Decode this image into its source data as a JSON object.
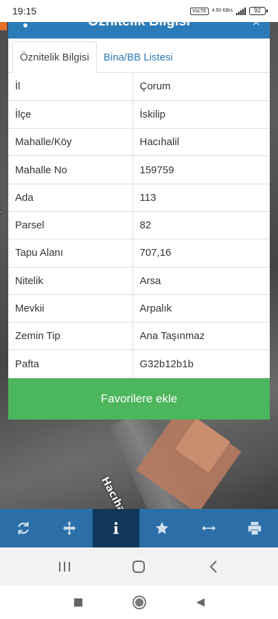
{
  "status_bar": {
    "time": "19:15",
    "network": "VoLTE",
    "speed": "4.50 KB/s",
    "battery": "92"
  },
  "panel": {
    "title": "Öznitelik Bilgisi",
    "tabs": [
      {
        "label": "Öznitelik Bilgisi",
        "active": true
      },
      {
        "label": "Bina/BB Listesi",
        "active": false
      }
    ],
    "rows": [
      {
        "key": "İl",
        "value": "Çorum"
      },
      {
        "key": "İlçe",
        "value": "İskilip"
      },
      {
        "key": "Mahalle/Köy",
        "value": "Hacıhalil"
      },
      {
        "key": "Mahalle No",
        "value": "159759"
      },
      {
        "key": "Ada",
        "value": "113"
      },
      {
        "key": "Parsel",
        "value": "82"
      },
      {
        "key": "Tapu Alanı",
        "value": "707,16"
      },
      {
        "key": "Nitelik",
        "value": "Arsa"
      },
      {
        "key": "Mevkii",
        "value": "Arpalık"
      },
      {
        "key": "Zemin Tip",
        "value": "Ana Taşınmaz"
      },
      {
        "key": "Pafta",
        "value": "G32b12b1b"
      }
    ],
    "favorite_button": "Favorilere ekle"
  },
  "map": {
    "street_label": "Hacıhali",
    "side_label": "Ha"
  },
  "toolbar": {
    "items": [
      {
        "icon": "refresh-icon",
        "active": false
      },
      {
        "icon": "move-icon",
        "active": false
      },
      {
        "icon": "info-icon",
        "active": true
      },
      {
        "icon": "star-icon",
        "active": false
      },
      {
        "icon": "measure-icon",
        "active": false
      },
      {
        "icon": "print-icon",
        "active": false
      }
    ]
  },
  "colors": {
    "header_blue": "#2b7bb9",
    "toolbar_blue": "#2c6fa8",
    "toolbar_active": "#11385a",
    "favorite_green": "#4cb65c"
  }
}
